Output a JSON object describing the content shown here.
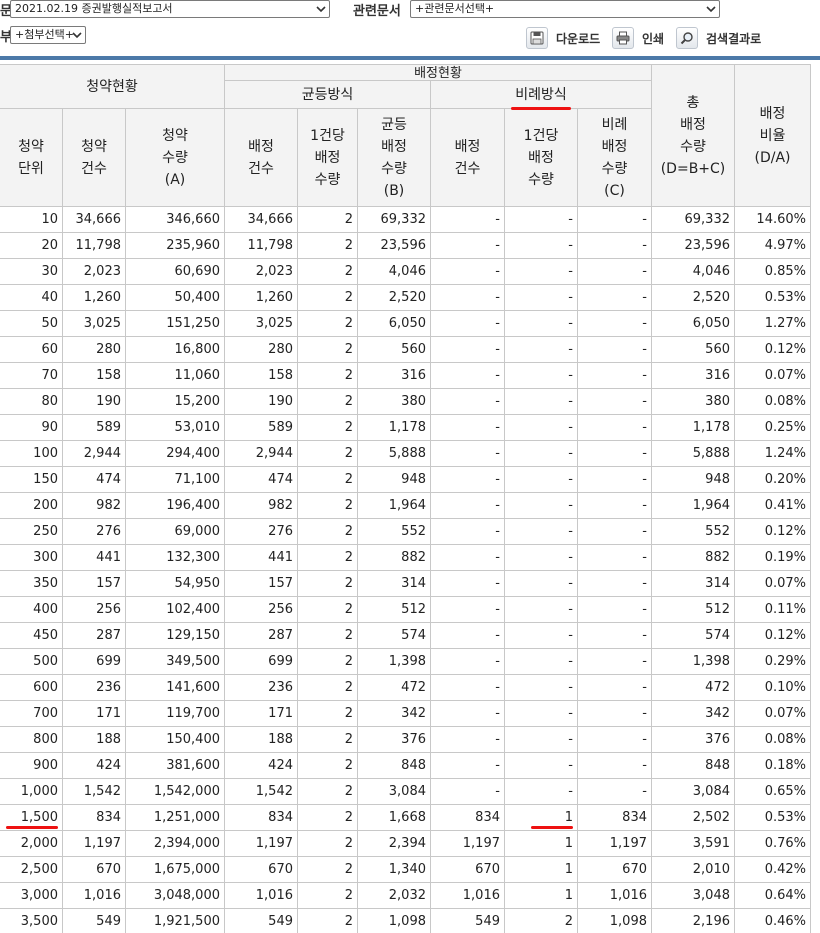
{
  "toolbar": {
    "left_label_1": "문",
    "left_label_2": "부",
    "date_report_select": "2021.02.19  증권발행실적보고서",
    "related_label": "관련문서",
    "related_select": "+관련문서선택+",
    "attach_select": "+첨부선택+",
    "download_label": "다운로드",
    "print_label": "인쇄",
    "search_result_label": "검색결과로",
    "icons": {
      "download": "save-icon",
      "print": "printer-icon",
      "search": "search-icon"
    }
  },
  "table": {
    "header": {
      "subscription_status": "청약현황",
      "allocation_status": "배정현황",
      "equal_method": "균등방식",
      "proportional_method": "비례방식",
      "total_alloc_qty": [
        "총",
        "배정",
        "수량",
        "(D=B+C)"
      ],
      "alloc_ratio": [
        "배정",
        "비율",
        "(D/A)"
      ],
      "sub_unit": [
        "청약",
        "단위"
      ],
      "sub_count": [
        "청약",
        "건수"
      ],
      "sub_qty": [
        "청약",
        "수량",
        "(A)"
      ],
      "eq_count": [
        "배정",
        "건수"
      ],
      "eq_per": [
        "1건당",
        "배정",
        "수량"
      ],
      "eq_qty": [
        "균등",
        "배정",
        "수량",
        "(B)"
      ],
      "pr_count": [
        "배정",
        "건수"
      ],
      "pr_per": [
        "1건당",
        "배정",
        "수량"
      ],
      "pr_qty": [
        "비례",
        "배정",
        "수량",
        "(C)"
      ]
    },
    "rows": [
      [
        "10",
        "34,666",
        "346,660",
        "34,666",
        "2",
        "69,332",
        "-",
        "-",
        "-",
        "69,332",
        "14.60%"
      ],
      [
        "20",
        "11,798",
        "235,960",
        "11,798",
        "2",
        "23,596",
        "-",
        "-",
        "-",
        "23,596",
        "4.97%"
      ],
      [
        "30",
        "2,023",
        "60,690",
        "2,023",
        "2",
        "4,046",
        "-",
        "-",
        "-",
        "4,046",
        "0.85%"
      ],
      [
        "40",
        "1,260",
        "50,400",
        "1,260",
        "2",
        "2,520",
        "-",
        "-",
        "-",
        "2,520",
        "0.53%"
      ],
      [
        "50",
        "3,025",
        "151,250",
        "3,025",
        "2",
        "6,050",
        "-",
        "-",
        "-",
        "6,050",
        "1.27%"
      ],
      [
        "60",
        "280",
        "16,800",
        "280",
        "2",
        "560",
        "-",
        "-",
        "-",
        "560",
        "0.12%"
      ],
      [
        "70",
        "158",
        "11,060",
        "158",
        "2",
        "316",
        "-",
        "-",
        "-",
        "316",
        "0.07%"
      ],
      [
        "80",
        "190",
        "15,200",
        "190",
        "2",
        "380",
        "-",
        "-",
        "-",
        "380",
        "0.08%"
      ],
      [
        "90",
        "589",
        "53,010",
        "589",
        "2",
        "1,178",
        "-",
        "-",
        "-",
        "1,178",
        "0.25%"
      ],
      [
        "100",
        "2,944",
        "294,400",
        "2,944",
        "2",
        "5,888",
        "-",
        "-",
        "-",
        "5,888",
        "1.24%"
      ],
      [
        "150",
        "474",
        "71,100",
        "474",
        "2",
        "948",
        "-",
        "-",
        "-",
        "948",
        "0.20%"
      ],
      [
        "200",
        "982",
        "196,400",
        "982",
        "2",
        "1,964",
        "-",
        "-",
        "-",
        "1,964",
        "0.41%"
      ],
      [
        "250",
        "276",
        "69,000",
        "276",
        "2",
        "552",
        "-",
        "-",
        "-",
        "552",
        "0.12%"
      ],
      [
        "300",
        "441",
        "132,300",
        "441",
        "2",
        "882",
        "-",
        "-",
        "-",
        "882",
        "0.19%"
      ],
      [
        "350",
        "157",
        "54,950",
        "157",
        "2",
        "314",
        "-",
        "-",
        "-",
        "314",
        "0.07%"
      ],
      [
        "400",
        "256",
        "102,400",
        "256",
        "2",
        "512",
        "-",
        "-",
        "-",
        "512",
        "0.11%"
      ],
      [
        "450",
        "287",
        "129,150",
        "287",
        "2",
        "574",
        "-",
        "-",
        "-",
        "574",
        "0.12%"
      ],
      [
        "500",
        "699",
        "349,500",
        "699",
        "2",
        "1,398",
        "-",
        "-",
        "-",
        "1,398",
        "0.29%"
      ],
      [
        "600",
        "236",
        "141,600",
        "236",
        "2",
        "472",
        "-",
        "-",
        "-",
        "472",
        "0.10%"
      ],
      [
        "700",
        "171",
        "119,700",
        "171",
        "2",
        "342",
        "-",
        "-",
        "-",
        "342",
        "0.07%"
      ],
      [
        "800",
        "188",
        "150,400",
        "188",
        "2",
        "376",
        "-",
        "-",
        "-",
        "376",
        "0.08%"
      ],
      [
        "900",
        "424",
        "381,600",
        "424",
        "2",
        "848",
        "-",
        "-",
        "-",
        "848",
        "0.18%"
      ],
      [
        "1,000",
        "1,542",
        "1,542,000",
        "1,542",
        "2",
        "3,084",
        "-",
        "-",
        "-",
        "3,084",
        "0.65%"
      ],
      [
        "1,500",
        "834",
        "1,251,000",
        "834",
        "2",
        "1,668",
        "834",
        "1",
        "834",
        "2,502",
        "0.53%"
      ],
      [
        "2,000",
        "1,197",
        "2,394,000",
        "1,197",
        "2",
        "2,394",
        "1,197",
        "1",
        "1,197",
        "3,591",
        "0.76%"
      ],
      [
        "2,500",
        "670",
        "1,675,000",
        "670",
        "2",
        "1,340",
        "670",
        "1",
        "670",
        "2,010",
        "0.42%"
      ],
      [
        "3,000",
        "1,016",
        "3,048,000",
        "1,016",
        "2",
        "2,032",
        "1,016",
        "1",
        "1,016",
        "3,048",
        "0.64%"
      ],
      [
        "3,500",
        "549",
        "1,921,500",
        "549",
        "2",
        "1,098",
        "549",
        "2",
        "1,098",
        "2,196",
        "0.46%"
      ]
    ]
  }
}
